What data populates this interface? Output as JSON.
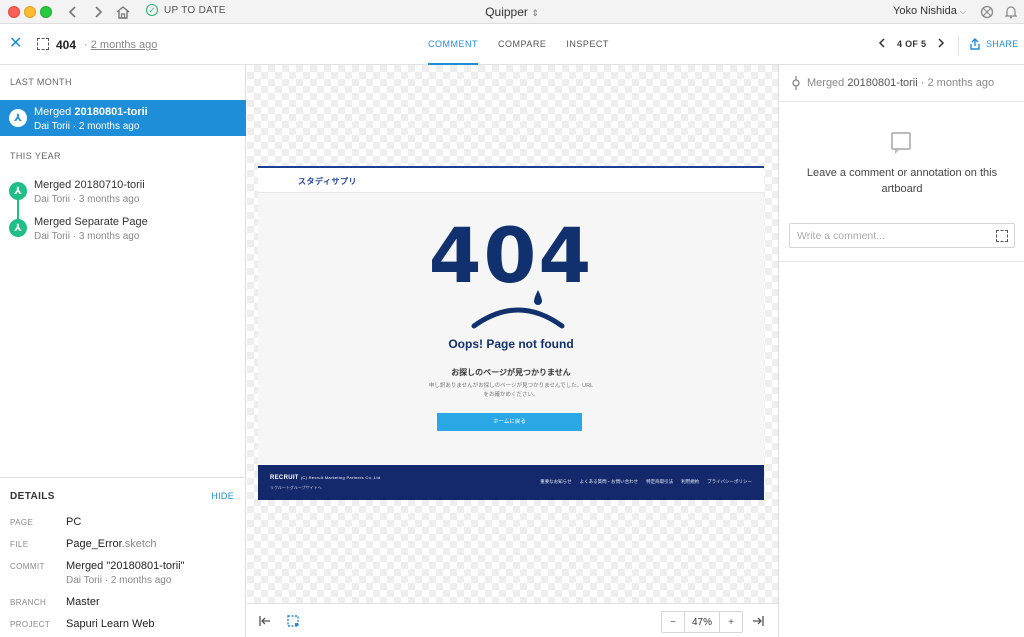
{
  "titlebar": {
    "status": "UP TO DATE",
    "app_name": "Quipper",
    "user_name": "Yoko Nishida"
  },
  "toolbar": {
    "artboard_name": "404",
    "separator": "·",
    "artboard_time": "2 months ago",
    "tabs": [
      "COMMENT",
      "COMPARE",
      "INSPECT"
    ],
    "active_tab": "COMMENT",
    "pager": "4 OF 5",
    "share_label": "SHARE"
  },
  "sidebar": {
    "sections": [
      {
        "label": "LAST MONTH",
        "commits": [
          {
            "prefix": "Merged",
            "name": "20180801-torii",
            "author": "Dai Torii · 2 months ago",
            "selected": true
          }
        ]
      },
      {
        "label": "THIS YEAR",
        "commits": [
          {
            "prefix": "Merged",
            "name": "20180710-torii",
            "author": "Dai Torii · 3 months ago",
            "selected": false
          },
          {
            "prefix": "Merged",
            "name": "Separate Page",
            "author": "Dai Torii · 3 months ago",
            "selected": false
          }
        ]
      }
    ],
    "details": {
      "heading": "DETAILS",
      "hide_label": "HIDE",
      "rows": [
        {
          "label": "PAGE",
          "value": "PC"
        },
        {
          "label": "FILE",
          "value": "Page_Error",
          "value_ext": ".sketch"
        },
        {
          "label": "COMMIT",
          "value": "Merged \"20180801-torii\"",
          "sub": "Dai Torii · 2 months ago"
        },
        {
          "label": "BRANCH",
          "value": "Master"
        },
        {
          "label": "PROJECT",
          "value": "Sapuri Learn Web"
        }
      ]
    }
  },
  "artboard": {
    "logo": "スタディサプリ",
    "code": "404",
    "headline": "Oops! Page not found",
    "jp_title": "お探しのページが見つかりません",
    "jp_body": "申し訳ありませんがお探しのページが見つかりませんでした。URLをお確かめください。",
    "home_button": "ホームに戻る",
    "footer_brand": "RECRUIT",
    "footer_copy": "(C) Recruit Marketing Partners Co.,Ltd",
    "footer_sub": "リクルートグループサイトへ",
    "footer_links": [
      "重要なお知らせ",
      "よくある質問・お問い合わせ",
      "特定商取引法",
      "利用規約",
      "プライバシーポリシー"
    ]
  },
  "bottombar": {
    "zoom_minus": "−",
    "zoom_value": "47%",
    "zoom_plus": "+"
  },
  "right_panel": {
    "commit_prefix": "Merged",
    "commit_name": "20180801-torii",
    "commit_time": "· 2 months ago",
    "empty_message": "Leave a comment or annotation on this artboard",
    "comment_placeholder": "Write a comment..."
  },
  "colors": {
    "accent": "#1f8ed8",
    "commit_green": "#1fbf87",
    "navy": "#11306e",
    "footer_navy": "#14296b"
  }
}
